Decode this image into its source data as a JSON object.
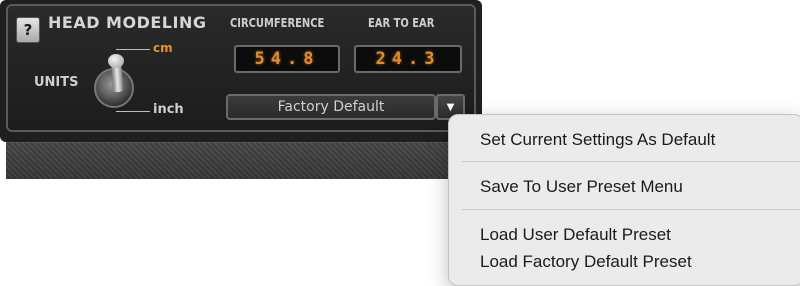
{
  "panel": {
    "help_label": "?",
    "title": "HEAD MODELING",
    "circumference_label": "CIRCUMFERENCE",
    "ear_to_ear_label": "EAR TO EAR",
    "circumference_value": "54.8",
    "ear_to_ear_value": "24.3",
    "units_label": "UNITS",
    "unit_cm": "cm",
    "unit_inch": "inch",
    "selected_unit": "cm",
    "preset_value": "Factory Default",
    "accent_color": "#e08d2a"
  },
  "menu": {
    "items": [
      "Set Current Settings As Default",
      "Save To User Preset Menu",
      "Load User Default Preset",
      "Load Factory Default Preset"
    ]
  }
}
